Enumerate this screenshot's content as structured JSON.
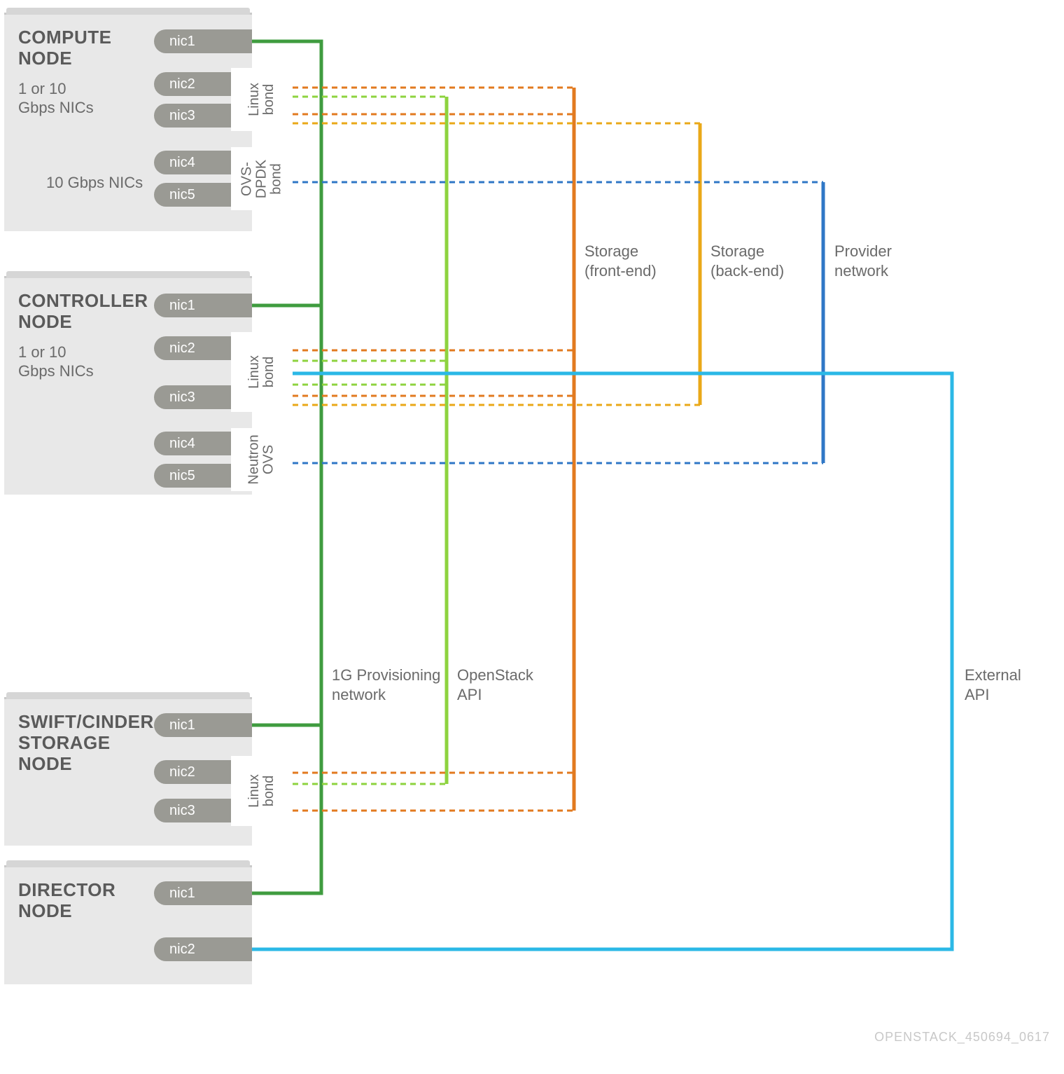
{
  "nodes": {
    "compute": {
      "title": "COMPUTE\nNODE",
      "sub1": "1 or 10\nGbps NICs",
      "sub2": "10 Gbps NICs",
      "nic1": "nic1",
      "nic2": "nic2",
      "nic3": "nic3",
      "nic4": "nic4",
      "nic5": "nic5",
      "bond1": "Linux\nbond",
      "bond2": "OVS-\nDPDK\nbond"
    },
    "controller": {
      "title": "CONTROLLER\nNODE",
      "sub1": "1 or 10\nGbps NICs",
      "nic1": "nic1",
      "nic2": "nic2",
      "nic3": "nic3",
      "nic4": "nic4",
      "nic5": "nic5",
      "bond1": "Linux\nbond",
      "bond2": "Neutron\nOVS"
    },
    "storage": {
      "title": "SWIFT/CINDER\nSTORAGE\nNODE",
      "nic1": "nic1",
      "nic2": "nic2",
      "nic3": "nic3",
      "bond1": "Linux\nbond"
    },
    "director": {
      "title": "DIRECTOR\nNODE",
      "nic1": "nic1",
      "nic2": "nic2"
    }
  },
  "labels": {
    "storage_front": "Storage\n(front-end)",
    "storage_back": "Storage\n(back-end)",
    "provider": "Provider\nnetwork",
    "provisioning": "1G Provisioning\nnetwork",
    "openstack_api": "OpenStack\nAPI",
    "external_api": "External\nAPI"
  },
  "footer": "OPENSTACK_450694_0617",
  "colors": {
    "green": "#3f9c3f",
    "lime": "#8ed33f",
    "orange": "#e27a1f",
    "amber": "#eaa818",
    "blue": "#2f77c6",
    "cyan": "#2bb8e6"
  }
}
